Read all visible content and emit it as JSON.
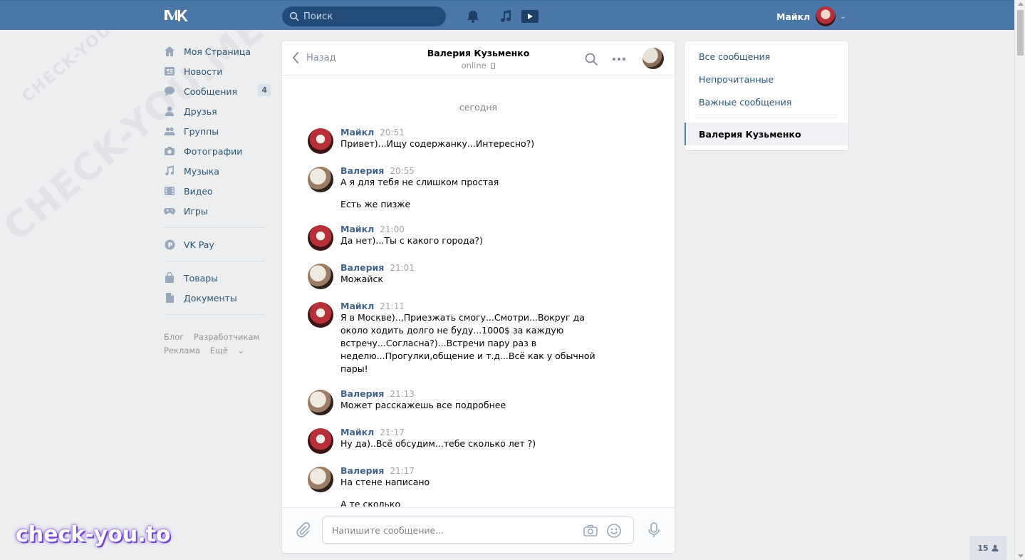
{
  "header": {
    "search_placeholder": "Поиск",
    "user_name": "Майкл"
  },
  "watermark": {
    "text": "CHECK-YOU.ME",
    "brand": "check-you.to"
  },
  "leftnav": {
    "items": [
      {
        "label": "Моя Страница",
        "icon": "home-icon"
      },
      {
        "label": "Новости",
        "icon": "news-icon"
      },
      {
        "label": "Сообщения",
        "icon": "messages-icon",
        "badge": "4"
      },
      {
        "label": "Друзья",
        "icon": "friends-icon"
      },
      {
        "label": "Группы",
        "icon": "groups-icon"
      },
      {
        "label": "Фотографии",
        "icon": "camera-icon"
      },
      {
        "label": "Музыка",
        "icon": "music-icon"
      },
      {
        "label": "Видео",
        "icon": "video-icon"
      },
      {
        "label": "Игры",
        "icon": "gamepad-icon"
      }
    ],
    "vkpay": "VK Pay",
    "extra": [
      {
        "label": "Товары",
        "icon": "bag-icon"
      },
      {
        "label": "Документы",
        "icon": "document-icon"
      }
    ],
    "footer": {
      "blog": "Блог",
      "developers": "Разработчикам",
      "ads": "Реклама",
      "more": "Ещё"
    }
  },
  "chat": {
    "back_label": "Назад",
    "peer_name": "Валерия Кузьменко",
    "peer_status": "online",
    "day_label": "сегодня",
    "messages": [
      {
        "author": "Майкл",
        "time": "20:51",
        "who": "maikl",
        "lines": [
          "Привет)...Ищу содержанку...Интересно?)"
        ]
      },
      {
        "author": "Валерия",
        "time": "20:55",
        "who": "valeria",
        "lines": [
          "А я для тебя не слишком простая",
          "Есть же пизже"
        ]
      },
      {
        "author": "Майкл",
        "time": "21:00",
        "who": "maikl",
        "lines": [
          "Да нет)...Ты с какого города?)"
        ]
      },
      {
        "author": "Валерия",
        "time": "21:01",
        "who": "valeria",
        "lines": [
          "Можайск"
        ]
      },
      {
        "author": "Майкл",
        "time": "21:11",
        "who": "maikl",
        "lines": [
          "Я в Москве)..,Приезжать смогу...Смотри...Вокруг да около ходить долго не буду...1000$ за каждую встречу...Согласна?)...Встречи пару раз в неделю...Прогулки,общение и т.д...Всё как у обычной пары!"
        ]
      },
      {
        "author": "Валерия",
        "time": "21:13",
        "who": "valeria",
        "lines": [
          "Может расскажешь все подробнее"
        ]
      },
      {
        "author": "Майкл",
        "time": "21:17",
        "who": "maikl",
        "lines": [
          "Ну да)..Всё обсудим...тебе сколько лет ?)"
        ]
      },
      {
        "author": "Валерия",
        "time": "21:17",
        "who": "valeria",
        "lines": [
          "На стене написано",
          "А те сколько"
        ]
      }
    ],
    "composer_placeholder": "Напишите сообщение..."
  },
  "rightmenu": {
    "all": "Все сообщения",
    "unread": "Непрочитанные",
    "important": "Важные сообщения",
    "active_dialog": "Валерия Кузьменко"
  },
  "online_widget": {
    "count": "15"
  },
  "colors": {
    "header": "#4a76a8",
    "link": "#285473",
    "author": "#42648b",
    "background": "#edeef0"
  }
}
